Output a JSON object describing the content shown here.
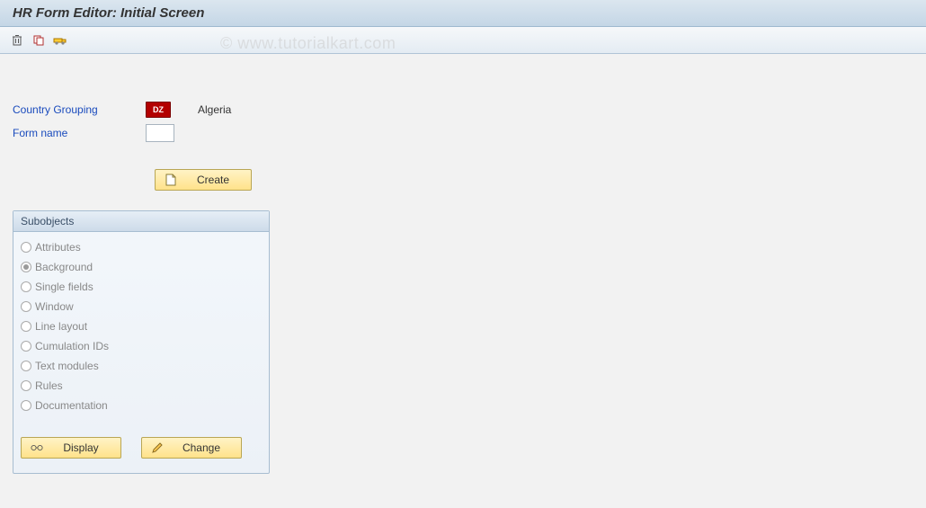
{
  "title": "HR Form Editor: Initial Screen",
  "watermark": "© www.tutorialkart.com",
  "fields": {
    "country_grouping": {
      "label": "Country Grouping",
      "value_code": "DZ",
      "value_text": "Algeria"
    },
    "form_name": {
      "label": "Form name",
      "value": ""
    }
  },
  "buttons": {
    "create": "Create",
    "display": "Display",
    "change": "Change"
  },
  "group": {
    "title": "Subobjects",
    "items": [
      {
        "label": "Attributes",
        "checked": false
      },
      {
        "label": "Background",
        "checked": true
      },
      {
        "label": "Single fields",
        "checked": false
      },
      {
        "label": "Window",
        "checked": false
      },
      {
        "label": "Line layout",
        "checked": false
      },
      {
        "label": "Cumulation IDs",
        "checked": false
      },
      {
        "label": "Text modules",
        "checked": false
      },
      {
        "label": "Rules",
        "checked": false
      },
      {
        "label": "Documentation",
        "checked": false
      }
    ]
  }
}
